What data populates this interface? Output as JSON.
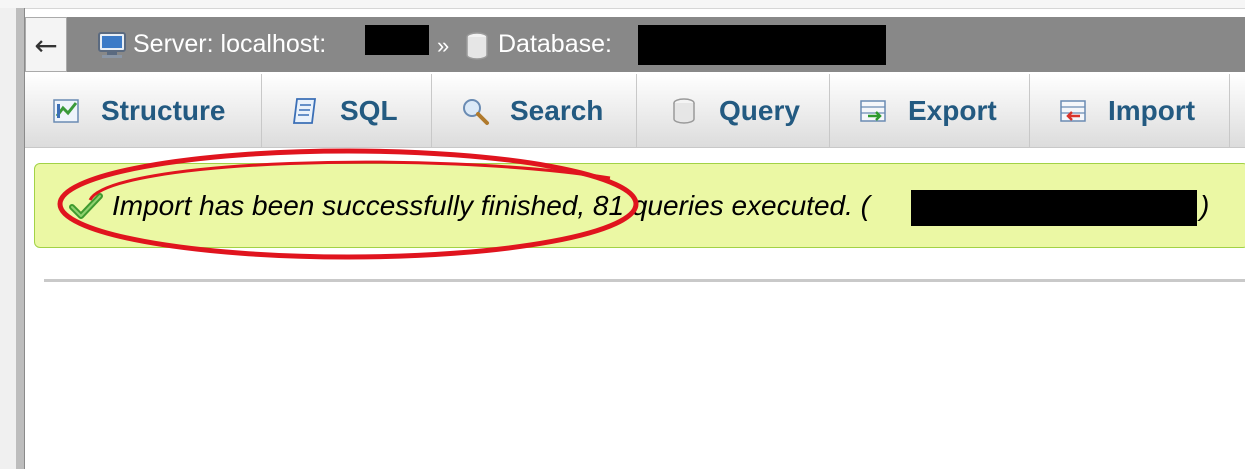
{
  "breadcrumb": {
    "back_label": "←",
    "server_label": "Server: localhost:",
    "separator": "»",
    "database_label": "Database:"
  },
  "tabs": [
    {
      "label": "Structure",
      "icon": "structure-icon"
    },
    {
      "label": "SQL",
      "icon": "sql-icon"
    },
    {
      "label": "Search",
      "icon": "search-icon"
    },
    {
      "label": "Query",
      "icon": "query-icon"
    },
    {
      "label": "Export",
      "icon": "export-icon"
    },
    {
      "label": "Import",
      "icon": "import-icon"
    }
  ],
  "message": {
    "text": "Import has been successfully finished, 81 queries executed. (",
    "close_paren": ")",
    "icon": "success-check-icon"
  },
  "colors": {
    "breadcrumb_bg": "#888888",
    "tab_text": "#235a81",
    "success_bg": "#ebf8a4",
    "success_border": "#a2d246",
    "annotation": "#e0141e"
  }
}
